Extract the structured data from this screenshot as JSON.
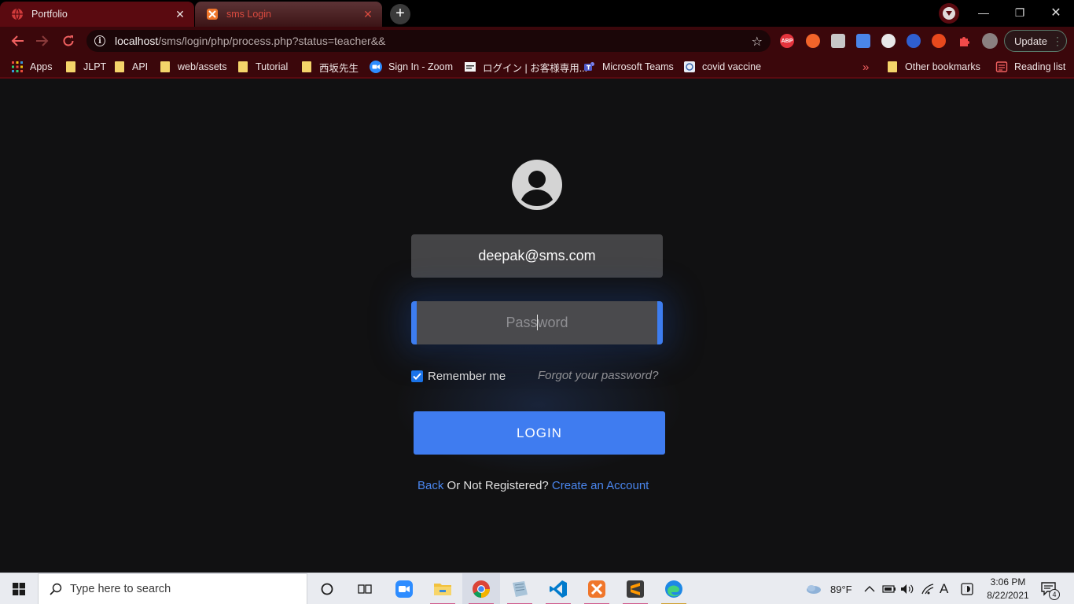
{
  "browser": {
    "tabs": [
      {
        "title": "Portfolio",
        "active": false
      },
      {
        "title": "sms Login",
        "active": true
      }
    ],
    "address": {
      "host": "localhost",
      "path": "/sms/login/php/process.php?status=teacher&&"
    },
    "update_label": "Update",
    "bookmarks": [
      {
        "label": "Apps",
        "icon": "apps-grid-icon"
      },
      {
        "label": "JLPT",
        "icon": "folder-icon"
      },
      {
        "label": "API",
        "icon": "folder-icon"
      },
      {
        "label": "web/assets",
        "icon": "folder-icon"
      },
      {
        "label": "Tutorial",
        "icon": "folder-icon"
      },
      {
        "label": "西坂先生",
        "icon": "folder-icon"
      },
      {
        "label": "Sign In - Zoom",
        "icon": "zoom-icon"
      },
      {
        "label": "ログイン | お客様専用...",
        "icon": "page-icon"
      },
      {
        "label": "Microsoft Teams",
        "icon": "teams-icon"
      },
      {
        "label": "covid vaccine",
        "icon": "vaccine-icon"
      }
    ],
    "overflow": "»",
    "other_bookmarks": "Other bookmarks",
    "reading_list": "Reading list",
    "extensions": {
      "abp": "ABP"
    }
  },
  "login": {
    "email_value": "deepak@sms.com",
    "password_placeholder": "Password",
    "remember_label": "Remember me",
    "remember_checked": true,
    "forgot_label": "Forgot your password?",
    "login_label": "LOGIN",
    "back_label": "Back",
    "or_text": " Or Not Registered? ",
    "create_label": "Create an Account"
  },
  "taskbar": {
    "search_placeholder": "Type here to search",
    "weather": "89°F",
    "time": "3:06 PM",
    "date": "8/22/2021",
    "ime": "A",
    "notifications": "4"
  },
  "colors": {
    "accent": "#3f7cf0",
    "link": "#4a86ee",
    "chrome_dark": "#3b070b"
  }
}
